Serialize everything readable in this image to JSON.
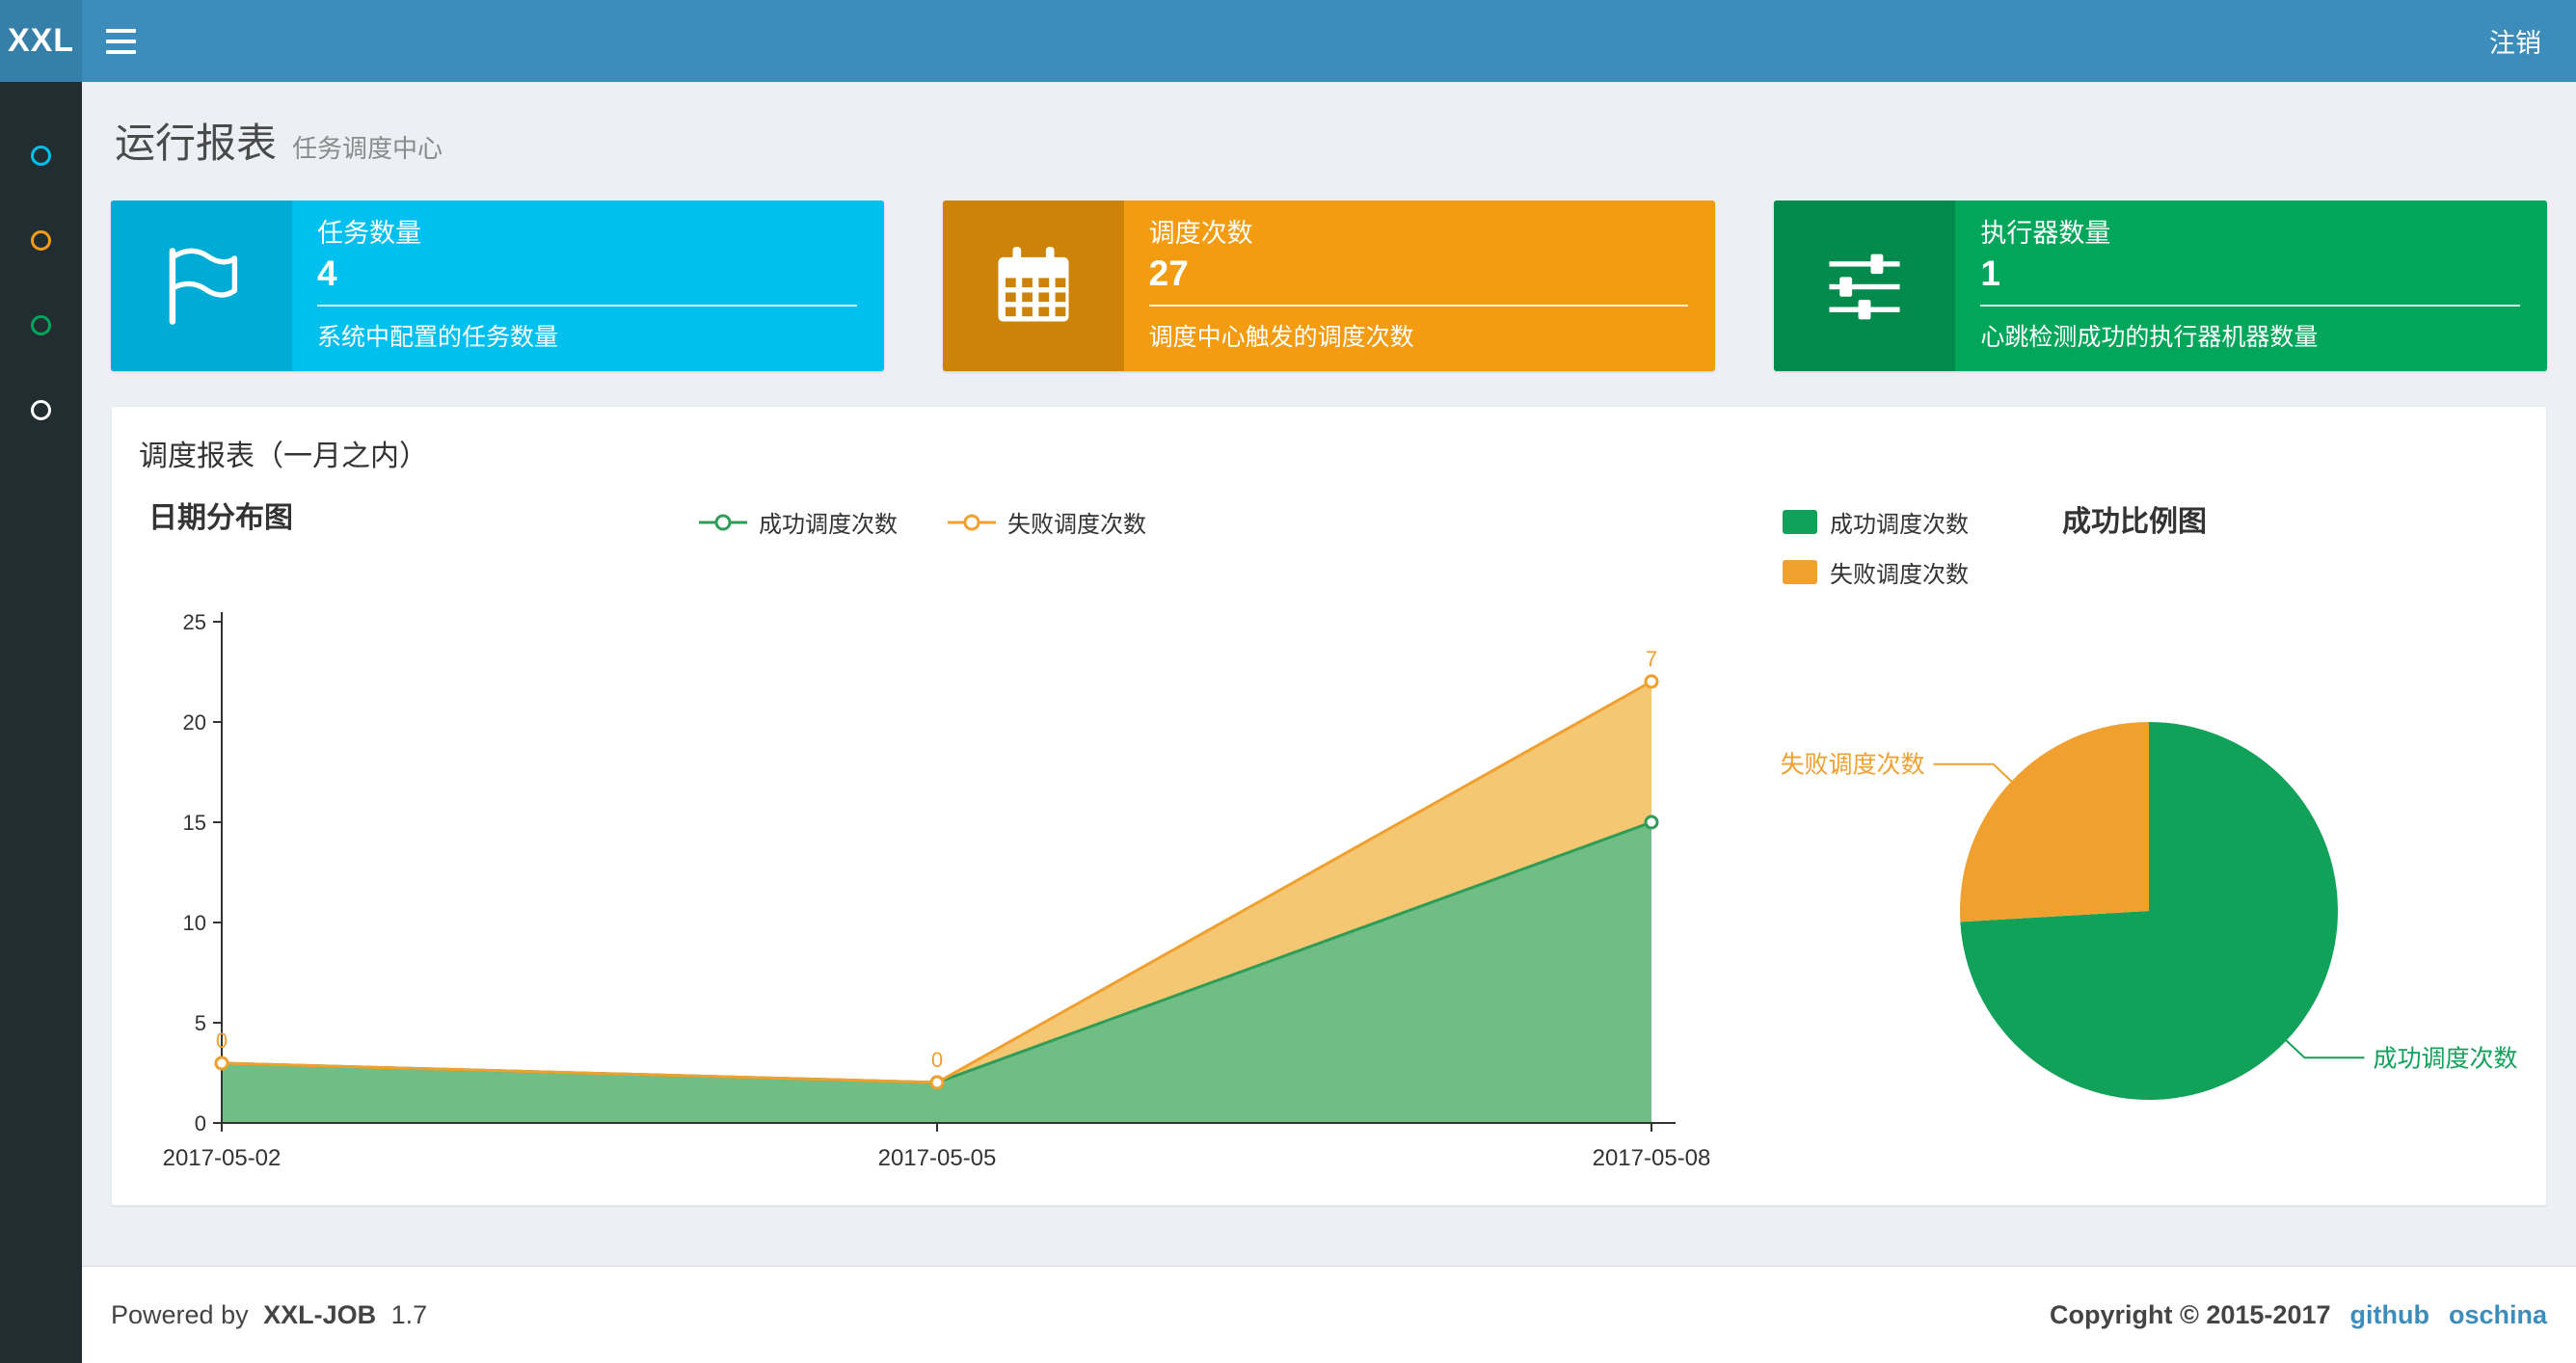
{
  "navbar": {
    "logo": "XXL",
    "logout_label": "注销"
  },
  "sidebar": {
    "items": [
      {
        "icon": "circle-icon",
        "color": "#00c0ef"
      },
      {
        "icon": "circle-icon",
        "color": "#f39c12"
      },
      {
        "icon": "circle-icon",
        "color": "#00a65a"
      },
      {
        "icon": "circle-icon",
        "color": "#ffffff"
      }
    ]
  },
  "header": {
    "title": "运行报表",
    "subtitle": "任务调度中心"
  },
  "info_boxes": [
    {
      "title": "任务数量",
      "value": "4",
      "desc": "系统中配置的任务数量",
      "color": "#00c0ef",
      "icon_bg": "#00abd6",
      "icon": "flag-icon"
    },
    {
      "title": "调度次数",
      "value": "27",
      "desc": "调度中心触发的调度次数",
      "color": "#f39c12",
      "icon_bg": "#cd830a",
      "icon": "calendar-icon"
    },
    {
      "title": "执行器数量",
      "value": "1",
      "desc": "心跳检测成功的执行器机器数量",
      "color": "#00a65a",
      "icon_bg": "#008a4b",
      "icon": "sliders-icon"
    }
  ],
  "panel": {
    "title": "调度报表（一月之内）"
  },
  "chart_data": [
    {
      "type": "area",
      "title": "日期分布图",
      "x": [
        "2017-05-02",
        "2017-05-05",
        "2017-05-08"
      ],
      "ylim": [
        0,
        25
      ],
      "yticks": [
        0,
        5,
        10,
        15,
        20,
        25
      ],
      "legend_position": "top",
      "grid": false,
      "series": [
        {
          "name": "成功调度次数",
          "values": [
            3,
            2,
            15
          ],
          "color": "#2f9d58",
          "fill": "rgba(104,185,126,0.95)",
          "stack": "total"
        },
        {
          "name": "失败调度次数",
          "values": [
            0,
            0,
            7
          ],
          "color": "#f0a02f",
          "fill": "rgba(244,196,108,0.95)",
          "stack": "total",
          "labels": [
            "0",
            "0",
            "7"
          ]
        }
      ]
    },
    {
      "type": "pie",
      "title": "成功比例图",
      "legend_position": "left-top",
      "slices": [
        {
          "name": "成功调度次数",
          "value": 20,
          "color": "#12a158"
        },
        {
          "name": "失败调度次数",
          "value": 7,
          "color": "#f0a02f"
        }
      ]
    }
  ],
  "footer": {
    "powered_prefix": "Powered by",
    "product": "XXL-JOB",
    "version": "1.7",
    "copyright": "Copyright © 2015-2017",
    "links": [
      "github",
      "oschina"
    ]
  }
}
